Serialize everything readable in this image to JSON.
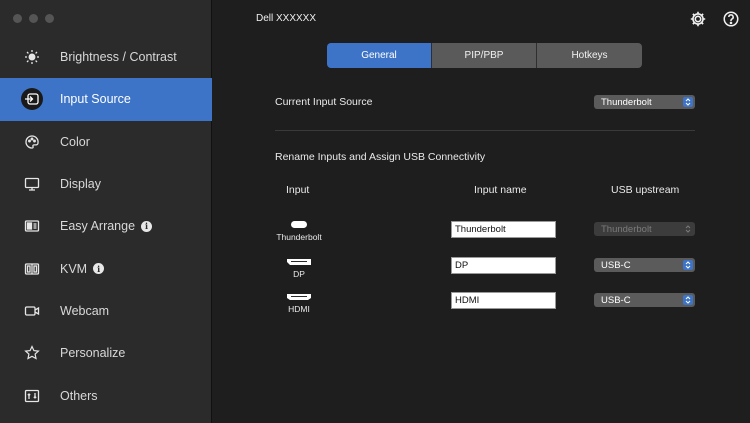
{
  "header": {
    "device_title": "Dell XXXXXX"
  },
  "sidebar": {
    "items": [
      {
        "label": "Brightness / Contrast",
        "icon": "sun-icon",
        "active": false
      },
      {
        "label": "Input Source",
        "icon": "input-source-icon",
        "active": true
      },
      {
        "label": "Color",
        "icon": "palette-icon",
        "active": false
      },
      {
        "label": "Display",
        "icon": "monitor-icon",
        "active": false
      },
      {
        "label": "Easy Arrange",
        "icon": "layout-icon",
        "active": false,
        "info": true
      },
      {
        "label": "KVM",
        "icon": "kvm-icon",
        "active": false,
        "info": true
      },
      {
        "label": "Webcam",
        "icon": "webcam-icon",
        "active": false
      },
      {
        "label": "Personalize",
        "icon": "star-icon",
        "active": false
      },
      {
        "label": "Others",
        "icon": "others-icon",
        "active": false
      }
    ]
  },
  "tabs": [
    {
      "label": "General",
      "active": true
    },
    {
      "label": "PIP/PBP",
      "active": false
    },
    {
      "label": "Hotkeys",
      "active": false
    }
  ],
  "general": {
    "current_input_label": "Current Input Source",
    "current_input_value": "Thunderbolt",
    "rename_heading": "Rename Inputs and Assign USB Connectivity",
    "columns": {
      "input": "Input",
      "input_name": "Input name",
      "usb_upstream": "USB upstream"
    },
    "rows": [
      {
        "port": "Thunderbolt",
        "name": "Thunderbolt",
        "usb": "Thunderbolt",
        "usb_disabled": true
      },
      {
        "port": "DP",
        "name": "DP",
        "usb": "USB-C",
        "usb_disabled": false
      },
      {
        "port": "HDMI",
        "name": "HDMI",
        "usb": "USB-C",
        "usb_disabled": false
      }
    ]
  },
  "colors": {
    "accent": "#3d74c7",
    "sidebar_bg": "#2b2b2b",
    "content_bg": "#1e1e1e"
  }
}
